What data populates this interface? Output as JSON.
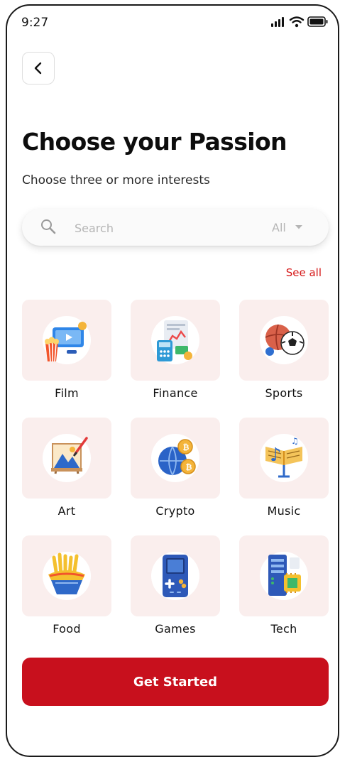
{
  "status_bar": {
    "time": "9:27"
  },
  "header": {
    "title": "Choose your Passion",
    "subtitle": "Choose three or more interests"
  },
  "search": {
    "placeholder": "Search",
    "filter_value": "All"
  },
  "see_all": "See all",
  "categories": [
    {
      "label": "Film",
      "icon": "film-icon"
    },
    {
      "label": "Finance",
      "icon": "finance-icon"
    },
    {
      "label": "Sports",
      "icon": "sports-icon"
    },
    {
      "label": "Art",
      "icon": "art-icon"
    },
    {
      "label": "Crypto",
      "icon": "crypto-icon"
    },
    {
      "label": "Music",
      "icon": "music-icon"
    },
    {
      "label": "Food",
      "icon": "food-icon"
    },
    {
      "label": "Games",
      "icon": "games-icon"
    },
    {
      "label": "Tech",
      "icon": "tech-icon"
    }
  ],
  "cta": {
    "label": "Get Started"
  },
  "colors": {
    "accent": "#c8101d",
    "link": "#d51414",
    "tile_background": "#faeeed"
  }
}
